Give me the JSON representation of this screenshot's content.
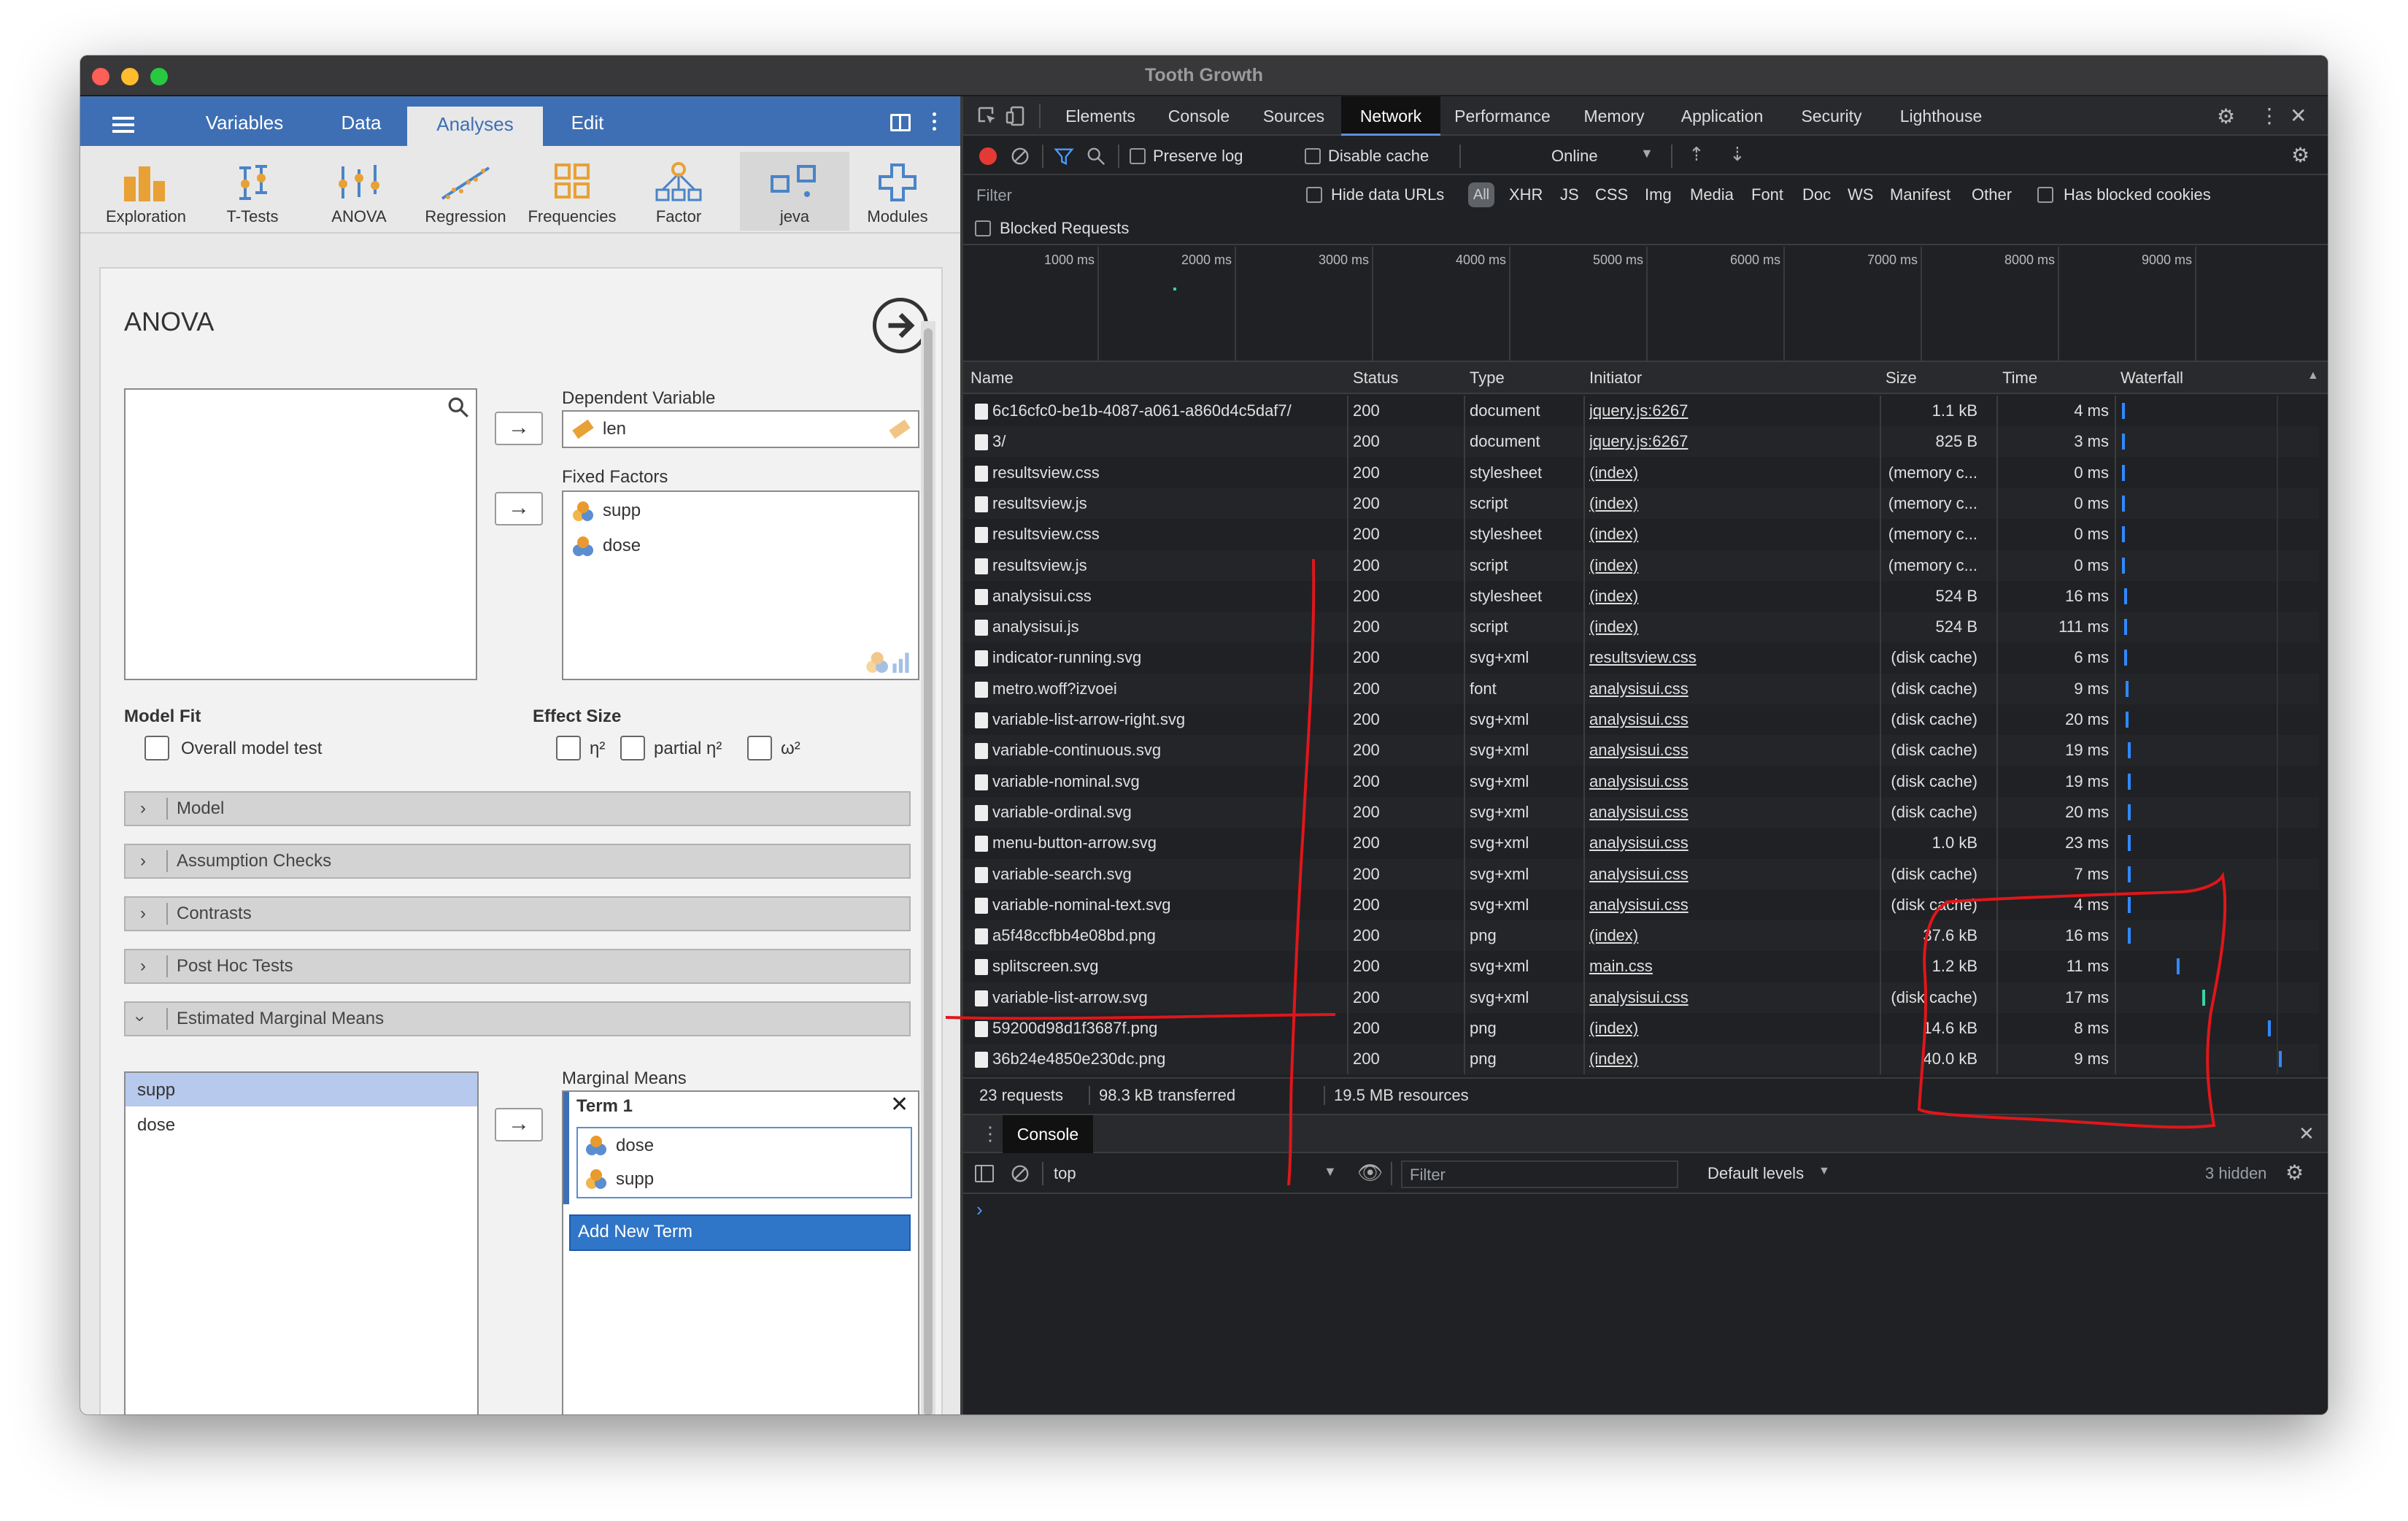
{
  "window": {
    "title": "Tooth Growth"
  },
  "jamovi": {
    "tabs": [
      "Variables",
      "Data",
      "Analyses",
      "Edit"
    ],
    "ribbon": [
      {
        "label": "Exploration",
        "icon": "exploration-icon"
      },
      {
        "label": "T-Tests",
        "icon": "t-tests-icon"
      },
      {
        "label": "ANOVA",
        "icon": "anova-icon"
      },
      {
        "label": "Regression",
        "icon": "regression-icon"
      },
      {
        "label": "Frequencies",
        "icon": "frequencies-icon"
      },
      {
        "label": "Factor",
        "icon": "factor-icon"
      },
      {
        "label": "jeva",
        "icon": "jeva-icon"
      },
      {
        "label": "Modules",
        "icon": "modules-icon"
      }
    ],
    "analysis": {
      "title": "ANOVA",
      "dependent_label": "Dependent Variable",
      "dependent_value": "len",
      "fixed_label": "Fixed Factors",
      "fixed_factors": [
        "supp",
        "dose"
      ],
      "model_fit_label": "Model Fit",
      "overall_model_test": "Overall model test",
      "effect_size_label": "Effect Size",
      "eta": "η²",
      "partial_eta": "partial η²",
      "omega": "ω²",
      "sections": [
        "Model",
        "Assumption Checks",
        "Contrasts",
        "Post Hoc Tests",
        "Estimated Marginal Means"
      ],
      "emm_vars": [
        "supp",
        "dose"
      ],
      "marginal_means_label": "Marginal Means",
      "term_label": "Term 1",
      "term_items": [
        "dose",
        "supp"
      ],
      "add_term": "Add New Term"
    }
  },
  "devtools": {
    "tabs": [
      "Elements",
      "Console",
      "Sources",
      "Network",
      "Performance",
      "Memory",
      "Application",
      "Security",
      "Lighthouse"
    ],
    "active_tab": "Network",
    "preserve_log": "Preserve log",
    "disable_cache": "Disable cache",
    "throttle": "Online",
    "filter_placeholder": "Filter",
    "hide_data_urls": "Hide data URLs",
    "types": [
      "All",
      "XHR",
      "JS",
      "CSS",
      "Img",
      "Media",
      "Font",
      "Doc",
      "WS",
      "Manifest",
      "Other"
    ],
    "has_blocked_cookies": "Has blocked cookies",
    "blocked_requests": "Blocked Requests",
    "timeline_ticks": [
      "1000 ms",
      "2000 ms",
      "3000 ms",
      "4000 ms",
      "5000 ms",
      "6000 ms",
      "7000 ms",
      "8000 ms",
      "9000 ms"
    ],
    "columns": [
      "Name",
      "Status",
      "Type",
      "Initiator",
      "Size",
      "Time",
      "Waterfall"
    ],
    "requests": [
      {
        "name": "6c16cfc0-be1b-4087-a061-a860d4c5daf7/",
        "status": "200",
        "type": "document",
        "initiator": "jquery.js:6267",
        "size": "1.1 kB",
        "time": "4 ms",
        "wf": 0.0
      },
      {
        "name": "3/",
        "status": "200",
        "type": "document",
        "initiator": "jquery.js:6267",
        "size": "825 B",
        "time": "3 ms",
        "wf": 0.0
      },
      {
        "name": "resultsview.css",
        "status": "200",
        "type": "stylesheet",
        "initiator": "(index)",
        "size": "(memory c...",
        "time": "0 ms",
        "wf": 0.0
      },
      {
        "name": "resultsview.js",
        "status": "200",
        "type": "script",
        "initiator": "(index)",
        "size": "(memory c...",
        "time": "0 ms",
        "wf": 0.0
      },
      {
        "name": "resultsview.css",
        "status": "200",
        "type": "stylesheet",
        "initiator": "(index)",
        "size": "(memory c...",
        "time": "0 ms",
        "wf": 0.0
      },
      {
        "name": "resultsview.js",
        "status": "200",
        "type": "script",
        "initiator": "(index)",
        "size": "(memory c...",
        "time": "0 ms",
        "wf": 0.0
      },
      {
        "name": "analysisui.css",
        "status": "200",
        "type": "stylesheet",
        "initiator": "(index)",
        "size": "524 B",
        "time": "16 ms",
        "wf": 0.01
      },
      {
        "name": "analysisui.js",
        "status": "200",
        "type": "script",
        "initiator": "(index)",
        "size": "524 B",
        "time": "111 ms",
        "wf": 0.01
      },
      {
        "name": "indicator-running.svg",
        "status": "200",
        "type": "svg+xml",
        "initiator": "resultsview.css",
        "size": "(disk cache)",
        "time": "6 ms",
        "wf": 0.01
      },
      {
        "name": "metro.woff?izvoei",
        "status": "200",
        "type": "font",
        "initiator": "analysisui.css",
        "size": "(disk cache)",
        "time": "9 ms",
        "wf": 0.02
      },
      {
        "name": "variable-list-arrow-right.svg",
        "status": "200",
        "type": "svg+xml",
        "initiator": "analysisui.css",
        "size": "(disk cache)",
        "time": "20 ms",
        "wf": 0.02
      },
      {
        "name": "variable-continuous.svg",
        "status": "200",
        "type": "svg+xml",
        "initiator": "analysisui.css",
        "size": "(disk cache)",
        "time": "19 ms",
        "wf": 0.03
      },
      {
        "name": "variable-nominal.svg",
        "status": "200",
        "type": "svg+xml",
        "initiator": "analysisui.css",
        "size": "(disk cache)",
        "time": "19 ms",
        "wf": 0.03
      },
      {
        "name": "variable-ordinal.svg",
        "status": "200",
        "type": "svg+xml",
        "initiator": "analysisui.css",
        "size": "(disk cache)",
        "time": "20 ms",
        "wf": 0.03
      },
      {
        "name": "menu-button-arrow.svg",
        "status": "200",
        "type": "svg+xml",
        "initiator": "analysisui.css",
        "size": "1.0 kB",
        "time": "23 ms",
        "wf": 0.03
      },
      {
        "name": "variable-search.svg",
        "status": "200",
        "type": "svg+xml",
        "initiator": "analysisui.css",
        "size": "(disk cache)",
        "time": "7 ms",
        "wf": 0.03
      },
      {
        "name": "variable-nominal-text.svg",
        "status": "200",
        "type": "svg+xml",
        "initiator": "analysisui.css",
        "size": "(disk cache)",
        "time": "4 ms",
        "wf": 0.03
      },
      {
        "name": "a5f48ccfbb4e08bd.png",
        "status": "200",
        "type": "png",
        "initiator": "(index)",
        "size": "37.6 kB",
        "time": "16 ms",
        "wf": 0.03
      },
      {
        "name": "splitscreen.svg",
        "status": "200",
        "type": "svg+xml",
        "initiator": "main.css",
        "size": "1.2 kB",
        "time": "11 ms",
        "wf": 0.3
      },
      {
        "name": "variable-list-arrow.svg",
        "status": "200",
        "type": "svg+xml",
        "initiator": "analysisui.css",
        "size": "(disk cache)",
        "time": "17 ms",
        "wf": 0.44
      },
      {
        "name": "59200d98d1f3687f.png",
        "status": "200",
        "type": "png",
        "initiator": "(index)",
        "size": "14.6 kB",
        "time": "8 ms",
        "wf": 0.8
      },
      {
        "name": "36b24e4850e230dc.png",
        "status": "200",
        "type": "png",
        "initiator": "(index)",
        "size": "40.0 kB",
        "time": "9 ms",
        "wf": 0.86
      }
    ],
    "summary": {
      "requests": "23 requests",
      "transferred": "98.3 kB transferred",
      "resources": "19.5 MB resources"
    },
    "drawer": {
      "tab": "Console",
      "context": "top",
      "filter_placeholder": "Filter",
      "levels": "Default levels",
      "hidden": "3 hidden",
      "prompt": "›"
    }
  },
  "colors": {
    "jamovi_blue": "#3e6fb4",
    "annotation_red": "#e0161b",
    "waterfall_blue": "#2f89ff",
    "record_red": "#e53935"
  }
}
